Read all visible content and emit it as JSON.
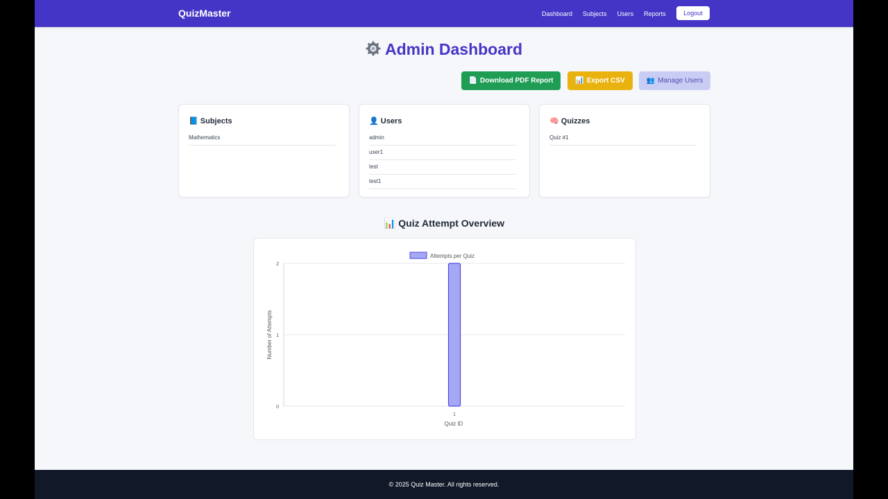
{
  "nav": {
    "brand": "QuizMaster",
    "links": [
      "Dashboard",
      "Subjects",
      "Users",
      "Reports"
    ],
    "logout": "Logout"
  },
  "page": {
    "title": "Admin Dashboard",
    "title_icon": "gear-icon"
  },
  "actions": {
    "pdf": "Download PDF Report",
    "csv": "Export CSV",
    "users": "Manage Users"
  },
  "cards": {
    "subjects": {
      "title": "Subjects",
      "icon": "📘",
      "items": [
        "Mathematics"
      ]
    },
    "users": {
      "title": "Users",
      "icon": "👤",
      "items": [
        "admin",
        "user1",
        "test",
        "test1"
      ]
    },
    "quizzes": {
      "title": "Quizzes",
      "icon": "🧠",
      "items": [
        "Quiz #1"
      ]
    }
  },
  "chart_section": {
    "title": "Quiz Attempt Overview",
    "icon": "📊"
  },
  "chart_data": {
    "type": "bar",
    "categories": [
      "1"
    ],
    "series": [
      {
        "name": "Attempts per Quiz",
        "values": [
          2
        ]
      }
    ],
    "xlabel": "Quiz ID",
    "ylabel": "Number of Attempts",
    "ylim": [
      0,
      2
    ],
    "yticks": [
      0,
      1,
      2
    ],
    "grid": true,
    "legend": "top-center",
    "colors": {
      "bar_fill": "#a5a8f5",
      "bar_stroke": "#4f46e5"
    }
  },
  "footer": {
    "text": "© 2025 Quiz Master. All rights reserved."
  },
  "colors": {
    "brand": "#4535c6",
    "success": "#1f9d55",
    "warning": "#e9b20e",
    "footer_bg": "#111827"
  }
}
